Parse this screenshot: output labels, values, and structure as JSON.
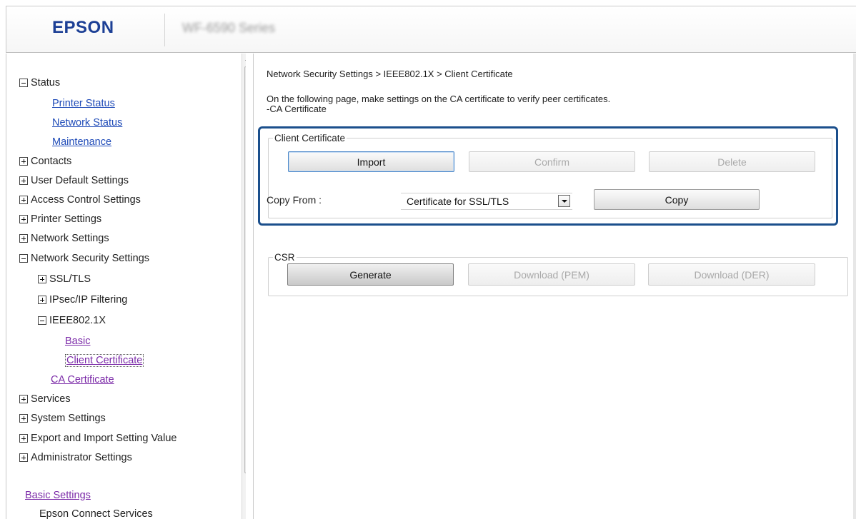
{
  "header": {
    "logo": "EPSON",
    "model": "WF-6590 Series"
  },
  "sidebar": {
    "items": [
      {
        "label": "Status",
        "type": "section",
        "state": "expanded"
      },
      {
        "label": "Printer Status",
        "type": "link"
      },
      {
        "label": "Network Status",
        "type": "link"
      },
      {
        "label": "Maintenance",
        "type": "link"
      },
      {
        "label": "Contacts",
        "type": "section",
        "state": "collapsed"
      },
      {
        "label": "User Default Settings",
        "type": "section",
        "state": "collapsed"
      },
      {
        "label": "Access Control Settings",
        "type": "section",
        "state": "collapsed"
      },
      {
        "label": "Printer Settings",
        "type": "section",
        "state": "collapsed"
      },
      {
        "label": "Network Settings",
        "type": "section",
        "state": "collapsed"
      },
      {
        "label": "Network Security Settings",
        "type": "section",
        "state": "expanded"
      },
      {
        "label": "SSL/TLS",
        "type": "subsection",
        "state": "collapsed"
      },
      {
        "label": "IPsec/IP Filtering",
        "type": "subsection",
        "state": "collapsed"
      },
      {
        "label": "IEEE802.1X",
        "type": "subsection",
        "state": "expanded"
      },
      {
        "label": "Basic",
        "type": "link"
      },
      {
        "label": "Client Certificate",
        "type": "link",
        "active": true
      },
      {
        "label": "CA Certificate",
        "type": "link"
      },
      {
        "label": "Services",
        "type": "section",
        "state": "collapsed"
      },
      {
        "label": "System Settings",
        "type": "section",
        "state": "collapsed"
      },
      {
        "label": "Export and Import Setting Value",
        "type": "section",
        "state": "collapsed"
      },
      {
        "label": "Administrator Settings",
        "type": "section",
        "state": "collapsed"
      },
      {
        "label": "Basic Settings",
        "type": "link"
      },
      {
        "label": "Epson Connect Services",
        "type": "text"
      }
    ]
  },
  "main": {
    "breadcrumb": "Network Security Settings > IEEE802.1X > Client Certificate",
    "description_line1": "On the following page, make settings on the CA certificate to verify peer certificates.",
    "description_line2": "-CA Certificate",
    "client_certificate": {
      "legend": "Client Certificate",
      "import_label": "Import",
      "confirm_label": "Confirm",
      "delete_label": "Delete",
      "copy_from_label": "Copy From :",
      "copy_from_value": "Certificate for SSL/TLS",
      "copy_label": "Copy"
    },
    "csr": {
      "legend": "CSR",
      "generate_label": "Generate",
      "download_pem_label": "Download (PEM)",
      "download_der_label": "Download (DER)"
    }
  },
  "colors": {
    "logo": "#1c3f95",
    "link": "#1f4bb8",
    "visited_link": "#7b2aa8",
    "highlight_border": "#1b4f8c"
  }
}
